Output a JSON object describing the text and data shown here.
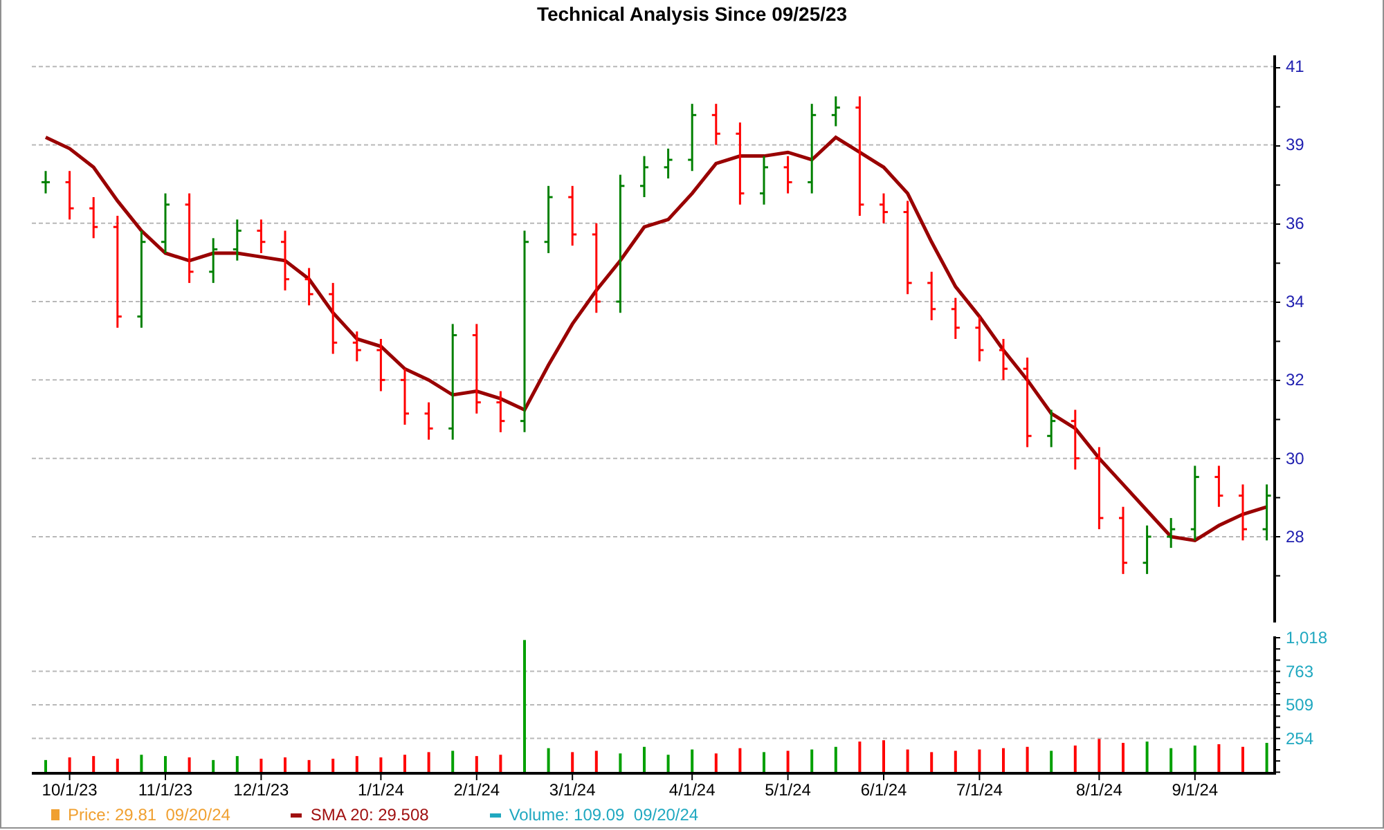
{
  "title": "Technical Analysis Since 09/25/23",
  "price_chart": {
    "chart_data": {
      "type": "line",
      "grid": true,
      "ylim": [
        25.7,
        40.9
      ],
      "yticks": [
        {
          "value": 40.6,
          "label": "41"
        },
        {
          "value": 38.5,
          "label": "39"
        },
        {
          "value": 36.4,
          "label": "36"
        },
        {
          "value": 34.3,
          "label": "34"
        },
        {
          "value": 32.2,
          "label": "32"
        },
        {
          "value": 30.1,
          "label": "30"
        },
        {
          "value": 28,
          "label": "28"
        }
      ],
      "series": [
        {
          "color": "#990000",
          "values": [
            38.7,
            38.4,
            37.9,
            37.0,
            36.2,
            35.6,
            35.4,
            35.6,
            35.6,
            35.5,
            35.4,
            34.9,
            34.0,
            33.3,
            33.1,
            32.5,
            32.2,
            31.8,
            31.9,
            31.7,
            31.4,
            32.6,
            33.7,
            34.6,
            35.4,
            36.3,
            36.5,
            37.2,
            38.0,
            38.2,
            38.2,
            38.3,
            38.1,
            38.7,
            38.3,
            37.9,
            37.2,
            35.9,
            34.7,
            33.9,
            33.0,
            32.2,
            31.3,
            30.9,
            30.1,
            29.4,
            28.7,
            28.0,
            27.9,
            28.3,
            28.6,
            28.8
          ]
        }
      ]
    }
  },
  "volume_chart": {
    "chart_data": {
      "type": "bar",
      "grid": true,
      "ylim": [
        0,
        1028
      ],
      "categories": [
        null,
        "10/1/23",
        null,
        null,
        null,
        "11/1/23",
        null,
        null,
        null,
        "12/1/23",
        null,
        null,
        null,
        null,
        "1/1/24",
        null,
        null,
        null,
        "2/1/24",
        null,
        null,
        null,
        "3/1/24",
        null,
        null,
        null,
        null,
        "4/1/24",
        null,
        null,
        null,
        "5/1/24",
        null,
        null,
        null,
        "6/1/24",
        null,
        null,
        null,
        "7/1/24",
        null,
        null,
        null,
        null,
        "8/1/24",
        null,
        null,
        null,
        "9/1/24",
        null,
        null,
        null
      ],
      "yticks": [
        {
          "value": 254,
          "label": "254"
        },
        {
          "value": 509,
          "label": "509"
        },
        {
          "value": 763,
          "label": "763"
        },
        {
          "value": 1018,
          "label": "1,018"
        }
      ],
      "series": [
        {
          "color": "#00a000",
          "values": [
            90,
            null,
            null,
            null,
            130,
            120,
            null,
            90,
            120,
            null,
            null,
            null,
            null,
            null,
            null,
            null,
            null,
            160,
            null,
            null,
            1000,
            180,
            null,
            null,
            140,
            190,
            130,
            170,
            null,
            null,
            150,
            null,
            170,
            190,
            null,
            null,
            null,
            null,
            null,
            null,
            null,
            null,
            160,
            null,
            null,
            null,
            230,
            180,
            200,
            null,
            null,
            220
          ]
        },
        {
          "color": "#ff0000",
          "values": [
            null,
            110,
            120,
            100,
            null,
            null,
            110,
            null,
            null,
            100,
            110,
            90,
            100,
            120,
            110,
            130,
            150,
            null,
            120,
            130,
            null,
            null,
            150,
            160,
            null,
            null,
            null,
            null,
            140,
            180,
            null,
            160,
            null,
            null,
            230,
            240,
            170,
            150,
            160,
            170,
            180,
            190,
            null,
            200,
            250,
            220,
            null,
            null,
            null,
            210,
            190,
            null
          ]
        }
      ]
    }
  },
  "legend": [
    {
      "label": "Price: 29.81  09/20/24",
      "color": "#f0a030",
      "kind": "square"
    },
    {
      "label": "SMA 20: 29.508",
      "color": "#a01010",
      "kind": "dash"
    },
    {
      "label": "Volume: 109.09  09/20/24",
      "color": "#20a8c0",
      "kind": "dash"
    }
  ]
}
